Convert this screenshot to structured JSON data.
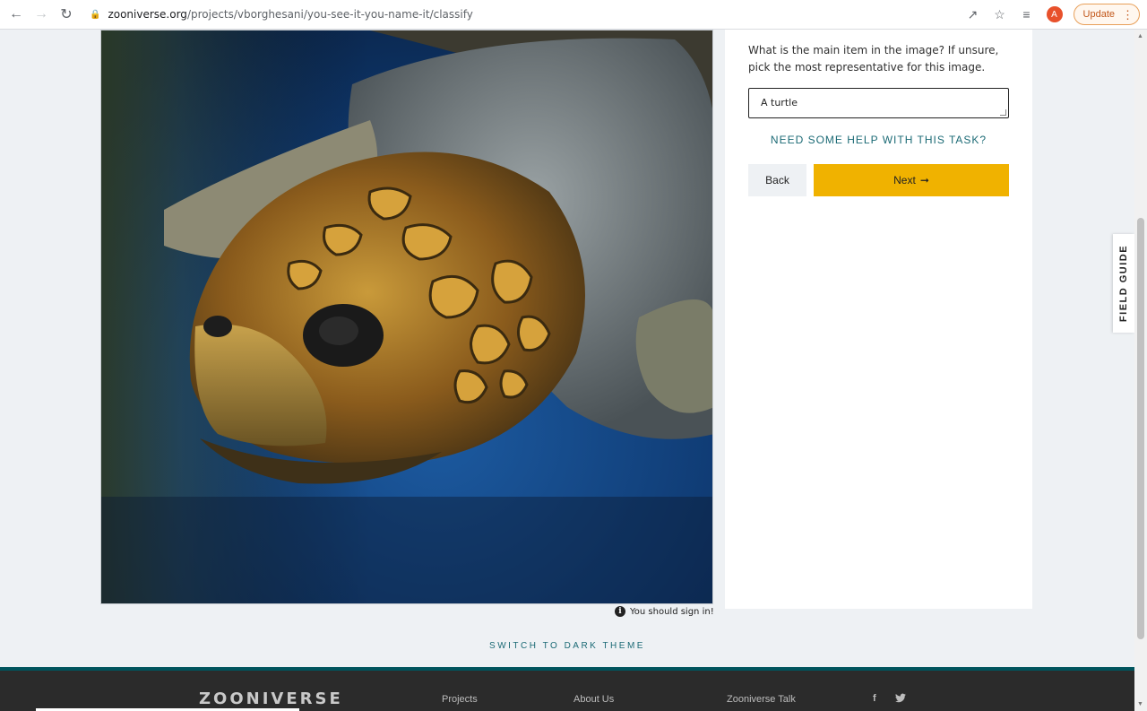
{
  "browser": {
    "url_host": "zooniverse.org",
    "url_path": "/projects/vborghesani/you-see-it-you-name-it/classify",
    "profile_initial": "A",
    "update_label": "Update"
  },
  "task": {
    "question": "What is the main item in the image? If unsure, pick the most representative for this image.",
    "answer_value": "A turtle",
    "help_label": "NEED SOME HELP WITH THIS TASK?",
    "back_label": "Back",
    "next_label": "Next",
    "next_arrow": "➞"
  },
  "subject": {
    "signin_note": "You should sign in!"
  },
  "field_guide": {
    "label": "FIELD GUIDE"
  },
  "theme_toggle": {
    "label": "SWITCH TO DARK THEME"
  },
  "footer": {
    "logo": "ZOONIVERSE",
    "links": [
      "Projects",
      "About Us",
      "Zooniverse Talk"
    ],
    "social": [
      "f",
      "t"
    ]
  },
  "colors": {
    "accent_yellow": "#f0b200",
    "teal": "#1b6a75",
    "footer_bg": "#2b2b2b"
  }
}
